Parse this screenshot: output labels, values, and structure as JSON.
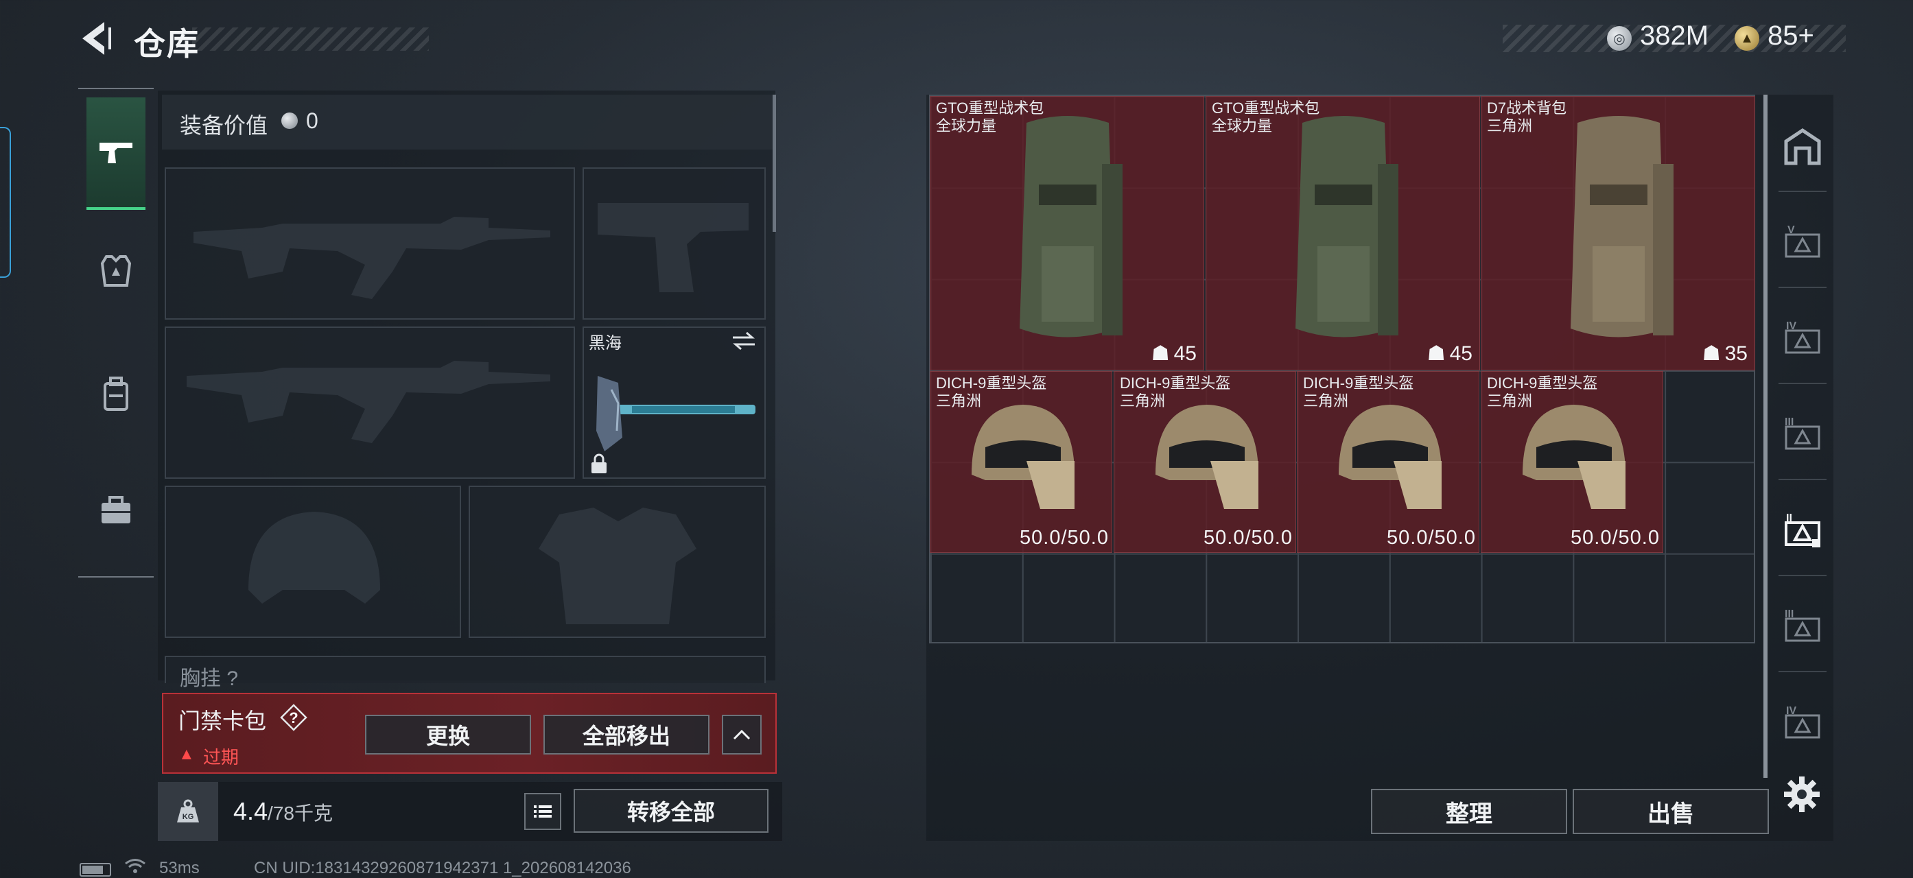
{
  "header": {
    "title": "仓库",
    "currencies": [
      {
        "icon": "silver-coin-icon",
        "value": "382M"
      },
      {
        "icon": "gold-bond-icon",
        "value": "85+"
      }
    ]
  },
  "sidebar": {
    "tabs": [
      {
        "icon": "pistol-icon",
        "active": true
      },
      {
        "icon": "armor-vest-icon",
        "active": false
      },
      {
        "icon": "backpack-icon",
        "active": false
      },
      {
        "icon": "briefcase-icon",
        "active": false
      }
    ]
  },
  "loadout": {
    "equip_value_label": "装备价值",
    "equip_value": "0",
    "melee_name": "黑海",
    "rig_label": "胸挂",
    "rig_help": "?"
  },
  "access_card": {
    "title": "门禁卡包",
    "help": "?",
    "warning_icon": "▲",
    "status": "过期",
    "replace_label": "更换",
    "move_all_out_label": "全部移出",
    "collapse_label": "^"
  },
  "weight": {
    "current": "4.4",
    "max": "/78千克",
    "transfer_all_label": "转移全部"
  },
  "status_bar": {
    "ping": "53ms",
    "uid": "CN UID:18314329260871942371 1_202608142036"
  },
  "stash": {
    "backpacks": [
      {
        "name": "GTO重型战术包",
        "map": "全球力量",
        "count": "45",
        "color": "#4e5a45"
      },
      {
        "name": "GTO重型战术包",
        "map": "全球力量",
        "count": "45",
        "color": "#4e5a45"
      },
      {
        "name": "D7战术背包",
        "map": "三角洲",
        "count": "35",
        "color": "#7d705a"
      }
    ],
    "helmets": [
      {
        "name": "DICH-9重型头盔",
        "map": "三角洲",
        "durability": "50.0/50.0"
      },
      {
        "name": "DICH-9重型头盔",
        "map": "三角洲",
        "durability": "50.0/50.0"
      },
      {
        "name": "DICH-9重型头盔",
        "map": "三角洲",
        "durability": "50.0/50.0"
      },
      {
        "name": "DICH-9重型头盔",
        "map": "三角洲",
        "durability": "50.0/50.0"
      }
    ],
    "sort_label": "整理",
    "sell_label": "出售"
  },
  "categories": [
    {
      "icon": "all-items-icon",
      "label": ""
    },
    {
      "icon": "tier-v-icon",
      "label": "V"
    },
    {
      "icon": "tier-iv-icon",
      "label": "IV"
    },
    {
      "icon": "tier-iii-icon",
      "label": "III"
    },
    {
      "icon": "tier-ii-icon",
      "label": "II",
      "active": true
    },
    {
      "icon": "tier-iii-icon",
      "label": "III"
    },
    {
      "icon": "tier-iv-icon",
      "label": "IV"
    }
  ],
  "colors": {
    "item_bg": "#5f1f26",
    "alert_red": "#b93138",
    "active_tab": "#46d38a"
  }
}
